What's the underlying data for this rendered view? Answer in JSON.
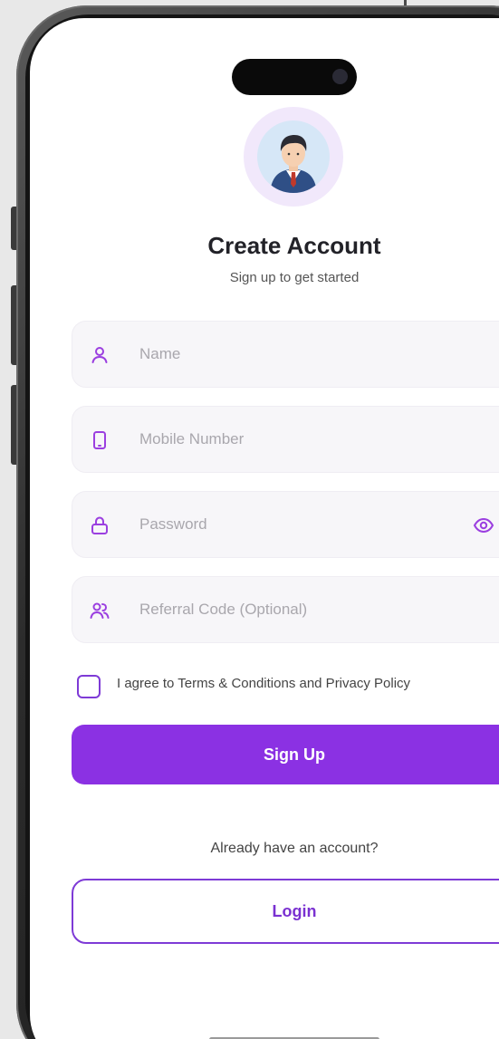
{
  "header": {
    "title": "Create Account",
    "subtitle": "Sign up to get started"
  },
  "form": {
    "name_placeholder": "Name",
    "mobile_placeholder": "Mobile Number",
    "password_placeholder": "Password",
    "referral_placeholder": "Referral Code (Optional)",
    "terms_checked": false,
    "terms_label": "I agree to Terms & Conditions and Privacy Policy"
  },
  "actions": {
    "signup_label": "Sign Up",
    "already_text": "Already have an account?",
    "login_label": "Login"
  },
  "icons": {
    "name": "user-icon",
    "mobile": "phone-icon",
    "password": "lock-icon",
    "password_toggle": "eye-icon",
    "referral": "users-icon",
    "avatar": "avatar-icon"
  },
  "colors": {
    "accent": "#8b31e3",
    "accent_border": "#7e3ad6",
    "field_bg": "#f7f6f9",
    "avatar_ring": "#f1e8fb"
  }
}
